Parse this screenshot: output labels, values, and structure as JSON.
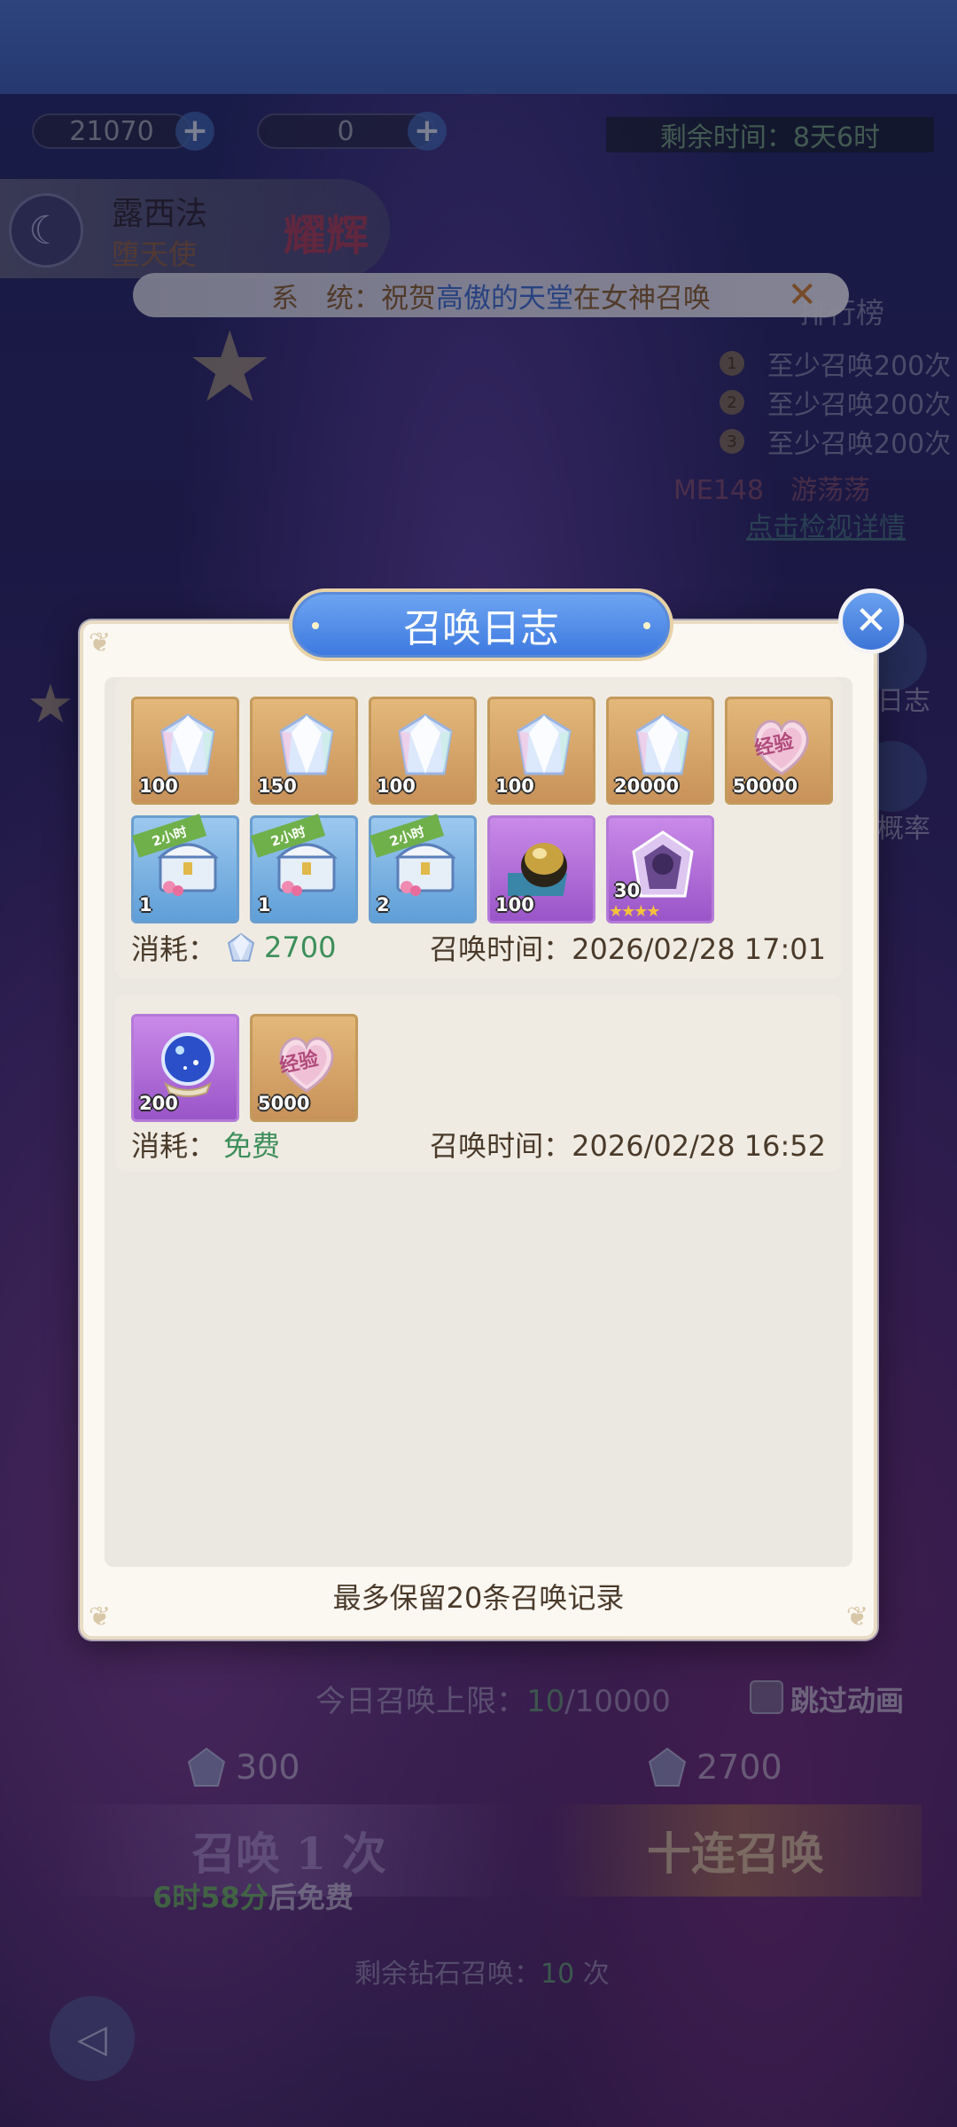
{
  "hud": {
    "gems": "21070",
    "moon": "0",
    "timer": "剩余时间：8天6时"
  },
  "hero": {
    "name": "露西法",
    "title": "堕天使",
    "badge": "耀辉"
  },
  "notice": {
    "prefix": "系　统：祝贺",
    "highlight1": "高傲的天堂",
    "middle": "在女神召唤"
  },
  "ranking": {
    "title": "排行榜",
    "rows": [
      "至少召唤200次",
      "至少召唤200次",
      "至少召唤200次"
    ],
    "user": "ME148　游荡荡",
    "detail": "点击检视详情"
  },
  "side": {
    "log_label": "日志",
    "rate_label": "概率"
  },
  "modal": {
    "title": "召唤日志",
    "footer": "最多保留20条召唤记录",
    "cost_label": "消耗：",
    "time_label": "召唤时间：",
    "records": [
      {
        "cost": "2700",
        "time": "2026/02/28 17:01",
        "items": [
          {
            "qty": "100",
            "kind": "gem",
            "frame": "gold"
          },
          {
            "qty": "150",
            "kind": "gem",
            "frame": "gold"
          },
          {
            "qty": "100",
            "kind": "gem",
            "frame": "gold"
          },
          {
            "qty": "100",
            "kind": "gem",
            "frame": "gold"
          },
          {
            "qty": "20000",
            "kind": "gem",
            "frame": "gold"
          },
          {
            "qty": "50000",
            "kind": "exp",
            "frame": "gold",
            "label": "经验"
          },
          {
            "qty": "1",
            "kind": "chest",
            "frame": "blue",
            "tag": "2小时"
          },
          {
            "qty": "1",
            "kind": "chest",
            "frame": "blue",
            "tag": "2小时"
          },
          {
            "qty": "2",
            "kind": "chest",
            "frame": "blue",
            "tag": "2小时"
          },
          {
            "qty": "100",
            "kind": "orb",
            "frame": "purple"
          },
          {
            "qty": "30",
            "kind": "shard",
            "frame": "purple",
            "stars": "★★★★"
          }
        ]
      },
      {
        "cost": "免费",
        "time": "2026/02/28 16:52",
        "items": [
          {
            "qty": "200",
            "kind": "crystal",
            "frame": "purple"
          },
          {
            "qty": "5000",
            "kind": "exp",
            "frame": "gold",
            "label": "经验"
          }
        ]
      }
    ]
  },
  "bottom": {
    "limit_prefix": "今日召唤上限：",
    "limit_value": "10",
    "limit_total": "/10000",
    "skip_label": "跳过动画",
    "cost_single": "300",
    "cost_ten": "2700",
    "summon_single": "召唤 1 次",
    "summon_ten": "十连召唤",
    "free_time": "6时58分",
    "free_suffix": "后免费",
    "remain_prefix": "剩余钻石召唤：",
    "remain_value": "10",
    "remain_suffix": " 次"
  },
  "colors": {
    "accent_blue": "#3c78e0",
    "cost_green": "#3d8f5a",
    "item_gold": "#c8925a",
    "item_purple": "#9a55c8",
    "item_blue": "#5f9fd8"
  }
}
